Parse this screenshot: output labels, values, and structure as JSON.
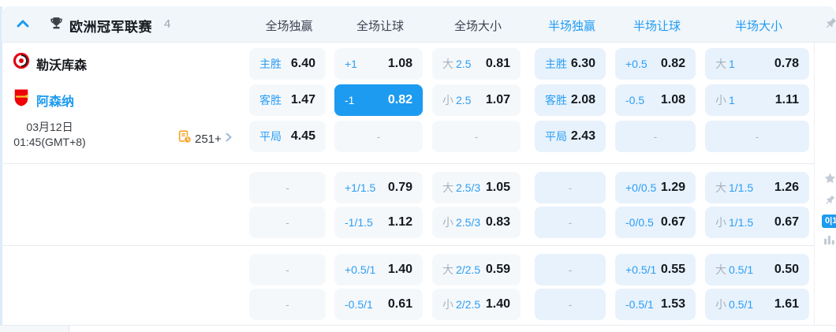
{
  "header": {
    "league_title": "欧洲冠军联赛",
    "match_count": "4",
    "columns": [
      {
        "label": "全场独赢",
        "scope": "full"
      },
      {
        "label": "全场让球",
        "scope": "full"
      },
      {
        "label": "全场大小",
        "scope": "full"
      },
      {
        "label": "半场独赢",
        "scope": "half"
      },
      {
        "label": "半场让球",
        "scope": "half"
      },
      {
        "label": "半场大小",
        "scope": "half"
      }
    ]
  },
  "match": {
    "home_team": "勒沃库森",
    "away_team": "阿森纳",
    "date": "03月12日",
    "time": "01:45(GMT+8)",
    "more_odds_count": "251+"
  },
  "gutter": {
    "corner_badge": "0|1"
  },
  "colors": {
    "accent_blue": "#1c9bf0",
    "selected_cell_bg": "#1c9bf0",
    "ft_cell_bg": "#f5f8fb",
    "ht_cell_bg": "#e8f2fc",
    "more_odds_icon": "#f7a62c"
  },
  "icons": {
    "collapse": "chevron-up-icon",
    "league": "trophy-icon",
    "pin": "pin-icon",
    "favorite": "star-icon",
    "stats": "bar-chart-icon",
    "more": "chevron-right-icon"
  },
  "odds": {
    "rows": [
      {
        "c1": {
          "label": "主胜",
          "value": "6.40"
        },
        "c2": {
          "label": "+1",
          "value": "1.08"
        },
        "c3": {
          "prefix": "大",
          "line": "2.5",
          "value": "0.81"
        },
        "c4": {
          "label": "主胜",
          "value": "6.30"
        },
        "c5": {
          "label": "+0.5",
          "value": "0.82"
        },
        "c6": {
          "prefix": "大",
          "line": "1",
          "value": "0.78"
        }
      },
      {
        "c1": {
          "label": "客胜",
          "value": "1.47"
        },
        "c2": {
          "label": "-1",
          "value": "0.82",
          "selected": true
        },
        "c3": {
          "prefix": "小",
          "line": "2.5",
          "value": "1.07"
        },
        "c4": {
          "label": "客胜",
          "value": "2.08"
        },
        "c5": {
          "label": "-0.5",
          "value": "1.08"
        },
        "c6": {
          "prefix": "小",
          "line": "1",
          "value": "1.11"
        }
      },
      {
        "c1": {
          "label": "平局",
          "value": "4.45"
        },
        "c2": {
          "dash": "-"
        },
        "c3": {
          "dash": "-"
        },
        "c4": {
          "label": "平局",
          "value": "2.43"
        },
        "c5": {
          "dash": "-"
        },
        "c6": {
          "dash": "-"
        }
      },
      {
        "c1": {
          "dash": "-"
        },
        "c2": {
          "label": "+1/1.5",
          "value": "0.79"
        },
        "c3": {
          "prefix": "大",
          "line": "2.5/3",
          "value": "1.05"
        },
        "c4": {
          "dash": "-"
        },
        "c5": {
          "label": "+0/0.5",
          "value": "1.29"
        },
        "c6": {
          "prefix": "大",
          "line": "1/1.5",
          "value": "1.26"
        }
      },
      {
        "c1": {
          "dash": "-"
        },
        "c2": {
          "label": "-1/1.5",
          "value": "1.12"
        },
        "c3": {
          "prefix": "小",
          "line": "2.5/3",
          "value": "0.83"
        },
        "c4": {
          "dash": "-"
        },
        "c5": {
          "label": "-0/0.5",
          "value": "0.67"
        },
        "c6": {
          "prefix": "小",
          "line": "1/1.5",
          "value": "0.67"
        }
      },
      {
        "c1": {
          "dash": "-"
        },
        "c2": {
          "label": "+0.5/1",
          "value": "1.40"
        },
        "c3": {
          "prefix": "大",
          "line": "2/2.5",
          "value": "0.59"
        },
        "c4": {
          "dash": "-"
        },
        "c5": {
          "label": "+0.5/1",
          "value": "0.55"
        },
        "c6": {
          "prefix": "大",
          "line": "0.5/1",
          "value": "0.50"
        }
      },
      {
        "c1": {
          "dash": "-"
        },
        "c2": {
          "label": "-0.5/1",
          "value": "0.61"
        },
        "c3": {
          "prefix": "小",
          "line": "2/2.5",
          "value": "1.40"
        },
        "c4": {
          "dash": "-"
        },
        "c5": {
          "label": "-0.5/1",
          "value": "1.53"
        },
        "c6": {
          "prefix": "小",
          "line": "0.5/1",
          "value": "1.61"
        }
      }
    ]
  }
}
